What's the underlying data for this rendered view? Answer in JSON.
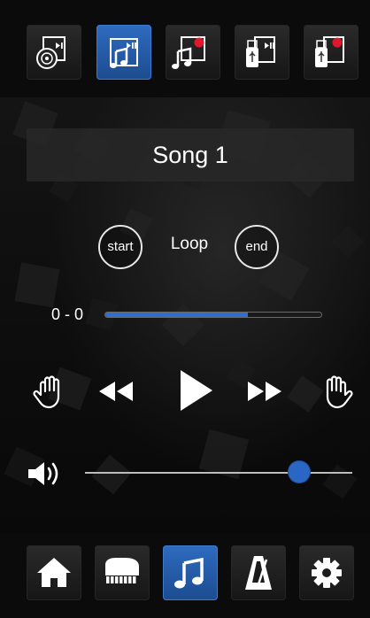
{
  "player": {
    "song_title": "Song 1",
    "loop_label": "Loop",
    "loop_start_label": "start",
    "loop_end_label": "end",
    "position_label": "0 - 0",
    "progress": 0.66,
    "volume": 0.8
  },
  "top_tabs": [
    {
      "icon": "cd-playback-icon",
      "active": false
    },
    {
      "icon": "music-playback-icon",
      "active": true
    },
    {
      "icon": "music-record-icon",
      "active": false
    },
    {
      "icon": "usb-playback-icon",
      "active": false
    },
    {
      "icon": "usb-record-icon",
      "active": false
    }
  ],
  "bottom_nav": [
    {
      "icon": "home-icon",
      "active": false
    },
    {
      "icon": "piano-icon",
      "active": false
    },
    {
      "icon": "music-note-icon",
      "active": true
    },
    {
      "icon": "metronome-icon",
      "active": false
    },
    {
      "icon": "gear-icon",
      "active": false
    }
  ],
  "colors": {
    "accent": "#2f6ecb",
    "record": "#e0182d",
    "background": "#0b0b0b"
  }
}
